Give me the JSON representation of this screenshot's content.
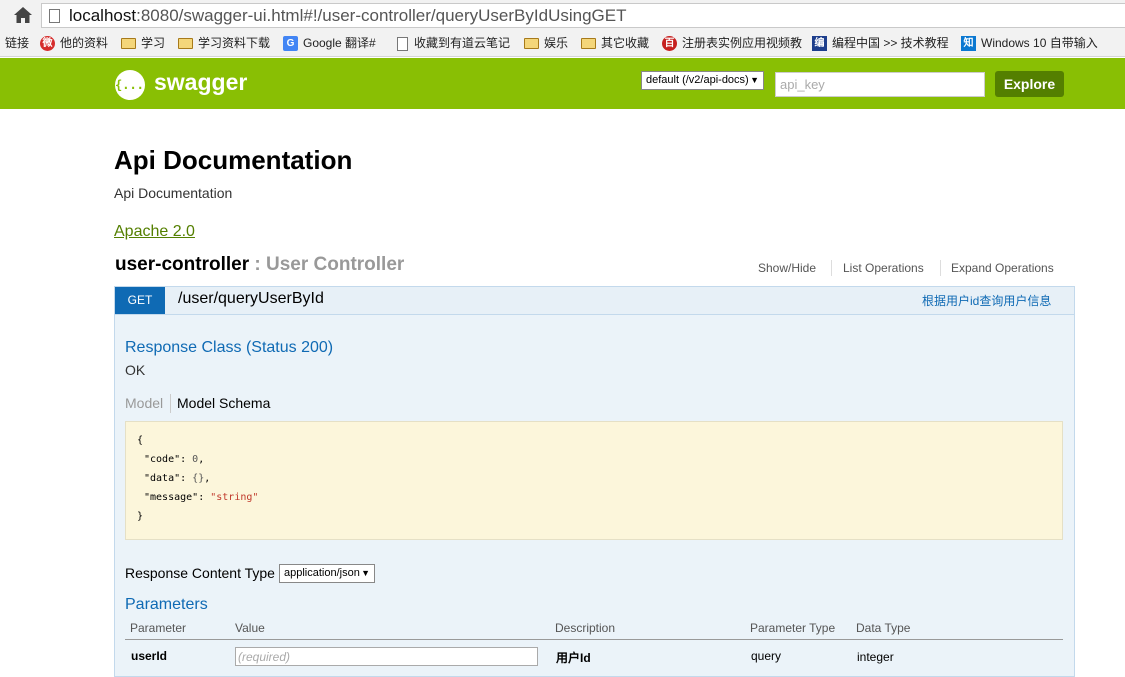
{
  "browser": {
    "url_host": "localhost",
    "url_rest": ":8080/swagger-ui.html#!/user-controller/queryUserByIdUsingGET",
    "bookmarks": [
      {
        "label": "链接",
        "kind": "text"
      },
      {
        "label": "他的资料",
        "kind": "weibo"
      },
      {
        "label": "学习",
        "kind": "folder"
      },
      {
        "label": "学习资料下载",
        "kind": "folder"
      },
      {
        "label": "Google 翻译#",
        "kind": "google"
      },
      {
        "label": "收藏到有道云笔记",
        "kind": "page"
      },
      {
        "label": "娱乐",
        "kind": "folder"
      },
      {
        "label": "其它收藏",
        "kind": "folder"
      },
      {
        "label": "注册表实例应用视频教",
        "kind": "baidu"
      },
      {
        "label": "编程中国 >> 技术教程",
        "kind": "bian"
      },
      {
        "label": "Windows 10 自带输入",
        "kind": "zhi"
      }
    ]
  },
  "header": {
    "logo_glyph": "{...}",
    "title": "swagger",
    "spec_selected": "default (/v2/api-docs)",
    "api_key_placeholder": "api_key",
    "explore_label": "Explore",
    "brand_color": "#89bf04"
  },
  "info": {
    "title": "Api Documentation",
    "description": "Api Documentation",
    "license": "Apache 2.0"
  },
  "controller": {
    "name": "user-controller",
    "separator": " : ",
    "description": "User Controller",
    "links": [
      "Show/Hide",
      "List Operations",
      "Expand Operations"
    ]
  },
  "operation": {
    "method": "GET",
    "path": "/user/queryUserById",
    "summary": "根据用户id查询用户信息",
    "method_color": "#0f6ab4",
    "response_class": "Response Class (Status 200)",
    "response_text": "OK",
    "tab_model": "Model",
    "tab_schema": "Model Schema",
    "schema": {
      "open": "{",
      "code_key": "\"code\"",
      "code_val": "0",
      "data_key": "\"data\"",
      "data_val": "{}",
      "message_key": "\"message\"",
      "message_val": "\"string\"",
      "close": "}"
    },
    "content_type_label": "Response Content Type",
    "content_type_value": "application/json",
    "parameters_title": "Parameters",
    "param_headers": [
      "Parameter",
      "Value",
      "Description",
      "Parameter Type",
      "Data Type"
    ],
    "params": [
      {
        "name": "userId",
        "placeholder": "(required)",
        "description": "用户Id",
        "param_type": "query",
        "data_type": "integer"
      }
    ]
  }
}
